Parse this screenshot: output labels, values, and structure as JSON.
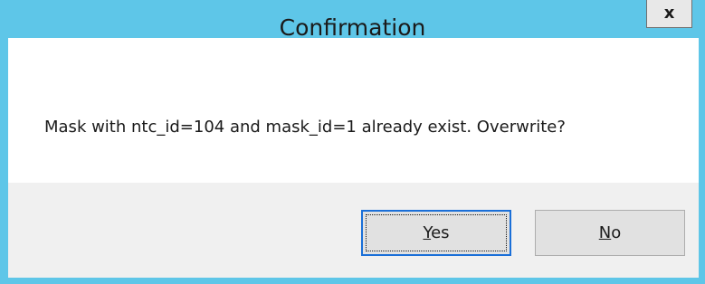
{
  "window": {
    "title": "Confirmation",
    "close_label": "x"
  },
  "message": {
    "text": "Mask with ntc_id=104 and mask_id=1 already exist. Overwrite?"
  },
  "buttons": {
    "yes": {
      "accel": "Y",
      "rest": "es"
    },
    "no": {
      "accel": "N",
      "rest": "o"
    }
  },
  "colors": {
    "titlebar": "#5ec6e8",
    "button_area": "#f0f0f0",
    "default_button_border": "#1a6fd8"
  }
}
